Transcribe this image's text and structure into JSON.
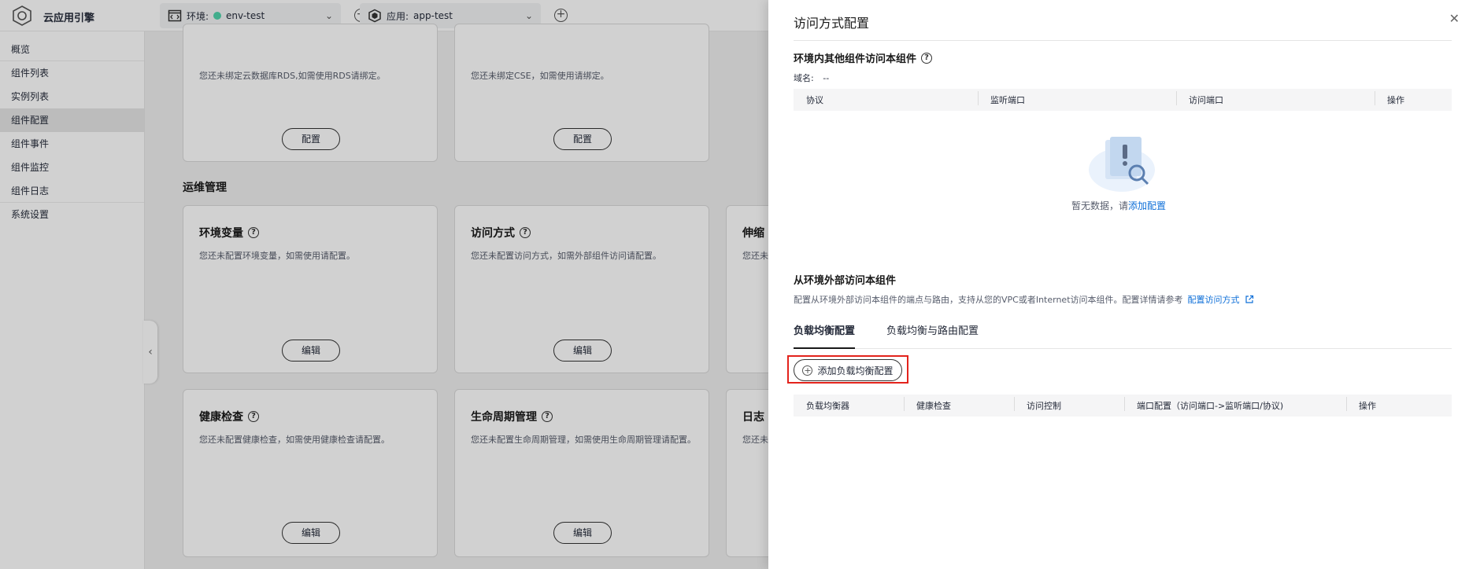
{
  "topbar": {
    "app_name": "云应用引擎",
    "env_label": "环境:",
    "env_value": "env-test",
    "app_label": "应用:",
    "app_value": "app-test"
  },
  "sidebar": {
    "items": [
      {
        "label": "概览"
      },
      {
        "label": "组件列表"
      },
      {
        "label": "实例列表"
      },
      {
        "label": "组件配置"
      },
      {
        "label": "组件事件"
      },
      {
        "label": "组件监控"
      },
      {
        "label": "组件日志"
      },
      {
        "label": "系统设置"
      }
    ]
  },
  "main": {
    "top_cards": [
      {
        "desc": "您还未绑定云数据库RDS,如需使用RDS请绑定。",
        "button": "配置"
      },
      {
        "desc": "您还未绑定CSE，如需使用请绑定。",
        "button": "配置"
      }
    ],
    "section_title": "运维管理",
    "cards_row1": [
      {
        "title": "环境变量",
        "desc": "您还未配置环境变量，如需使用请配置。",
        "button": "编辑"
      },
      {
        "title": "访问方式",
        "desc": "您还未配置访问方式，如需外部组件访问请配置。",
        "button": "编辑"
      },
      {
        "title": "伸缩",
        "desc": "您还未"
      }
    ],
    "cards_row2": [
      {
        "title": "健康检查",
        "desc": "您还未配置健康检查，如需使用健康检查请配置。",
        "button": "编辑"
      },
      {
        "title": "生命周期管理",
        "desc": "您还未配置生命周期管理，如需使用生命周期管理请配置。",
        "button": "编辑"
      },
      {
        "title": "日志",
        "desc": "您还未"
      }
    ]
  },
  "drawer": {
    "title": "访问方式配置",
    "internal_title": "环境内其他组件访问本组件",
    "domain_label": "域名:",
    "domain_value": "--",
    "internal_headers": [
      "协议",
      "监听端口",
      "访问端口",
      "操作"
    ],
    "empty_text": "暂无数据，请",
    "empty_link": "添加配置",
    "external_title": "从环境外部访问本组件",
    "external_desc": "配置从环境外部访问本组件的端点与路由，支持从您的VPC或者Internet访问本组件。配置详情请参考",
    "external_link": "配置访问方式",
    "tabs": [
      "负载均衡配置",
      "负载均衡与路由配置"
    ],
    "add_button": "添加负载均衡配置",
    "lb_headers": [
      "负载均衡器",
      "健康检查",
      "访问控制",
      "端口配置（访问端口->监听端口/协议)",
      "操作"
    ]
  }
}
